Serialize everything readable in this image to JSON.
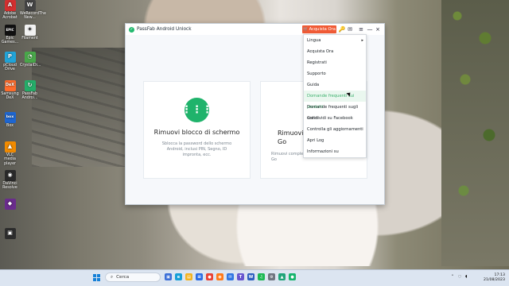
{
  "desktop": {
    "icons": [
      {
        "label": "Adobe Acrobat",
        "symbol": "A",
        "color": "#d32f2f"
      },
      {
        "label": "WeRecordThe New...",
        "symbol": "W",
        "color": "#444444"
      },
      {
        "label": "Epic Games...",
        "symbol": "EPIC",
        "color": "#111111"
      },
      {
        "label": "Filament",
        "symbol": "✦",
        "color": "#f2f2f2"
      },
      {
        "label": "pCloud Drive",
        "symbol": "P",
        "color": "#21a4d8"
      },
      {
        "label": "CrystalDi...",
        "symbol": "◔",
        "color": "#49a84a"
      },
      {
        "label": "Samsung DeX",
        "symbol": "DeX",
        "color": "#ff6d2d"
      },
      {
        "label": "PassFab Androi...",
        "symbol": "↻",
        "color": "#24ad69"
      },
      {
        "label": "Box",
        "symbol": "box",
        "color": "#1e66d0"
      },
      {
        "label": "VLC media player",
        "symbol": "▲",
        "color": "#f28b00"
      },
      {
        "label": "DaVinci Resolve",
        "symbol": "◉",
        "color": "#2a2a2a"
      },
      {
        "label": "",
        "symbol": "◆",
        "color": "#6a2c8c"
      },
      {
        "label": "",
        "symbol": "▣",
        "color": "#2d2d2d"
      }
    ]
  },
  "window": {
    "title": "PassFab Android Unlock",
    "buy_label": "Acquista Ora",
    "icons": [
      "key-icon",
      "feedback-icon",
      "menu-icon",
      "minimize-icon",
      "close-icon"
    ]
  },
  "cards": [
    {
      "title": "Rimuovi blocco di schermo",
      "description": "Sblocca la password dello schermo Android, inclusi PIN, Segno, ID impronta, ecc."
    },
    {
      "title": "Rimuovi il\nGo",
      "description": "Rimuovi complet\nGo"
    }
  ],
  "menu": {
    "items": [
      {
        "label": "Lingua",
        "has_submenu": true
      },
      {
        "label": "Acquista Ora"
      },
      {
        "label": "Registrati"
      },
      {
        "label": "Supporto"
      },
      {
        "label": "Guida"
      },
      {
        "label": "Domande frequenti sui prodotti",
        "selected": true
      },
      {
        "label": "Domande frequenti sugli ordini"
      },
      {
        "label": "Condividi su Facebook"
      },
      {
        "label": "Controlla gli aggiornamenti"
      },
      {
        "label": "Apri Log"
      },
      {
        "label": "Informazioni su"
      }
    ]
  },
  "taskbar": {
    "search_placeholder": "Cerca",
    "icons": [
      {
        "name": "task-view-icon",
        "symbol": "▣",
        "color": "#3b6fd8"
      },
      {
        "name": "edge-icon",
        "symbol": "e",
        "color": "#169fd8"
      },
      {
        "name": "file-explorer-icon",
        "symbol": "▤",
        "color": "#f3b321"
      },
      {
        "name": "store-icon",
        "symbol": "⊞",
        "color": "#2b6de5"
      },
      {
        "name": "chrome-icon",
        "symbol": "●",
        "color": "#e94235"
      },
      {
        "name": "firefox-icon",
        "symbol": "◉",
        "color": "#ff7a1a"
      },
      {
        "name": "mail-icon",
        "symbol": "✉",
        "color": "#3076e3"
      },
      {
        "name": "teams-icon",
        "symbol": "T",
        "color": "#6755cf"
      },
      {
        "name": "word-icon",
        "symbol": "W",
        "color": "#2d5fbf"
      },
      {
        "name": "spotify-icon",
        "symbol": "♫",
        "color": "#1db954"
      },
      {
        "name": "settings-icon",
        "symbol": "⚙",
        "color": "#6f7480"
      },
      {
        "name": "photos-icon",
        "symbol": "▲",
        "color": "#20a47a"
      },
      {
        "name": "app-icon",
        "symbol": "●",
        "color": "#16b46d"
      }
    ],
    "time": "17:13",
    "date": "21/08/2023"
  }
}
